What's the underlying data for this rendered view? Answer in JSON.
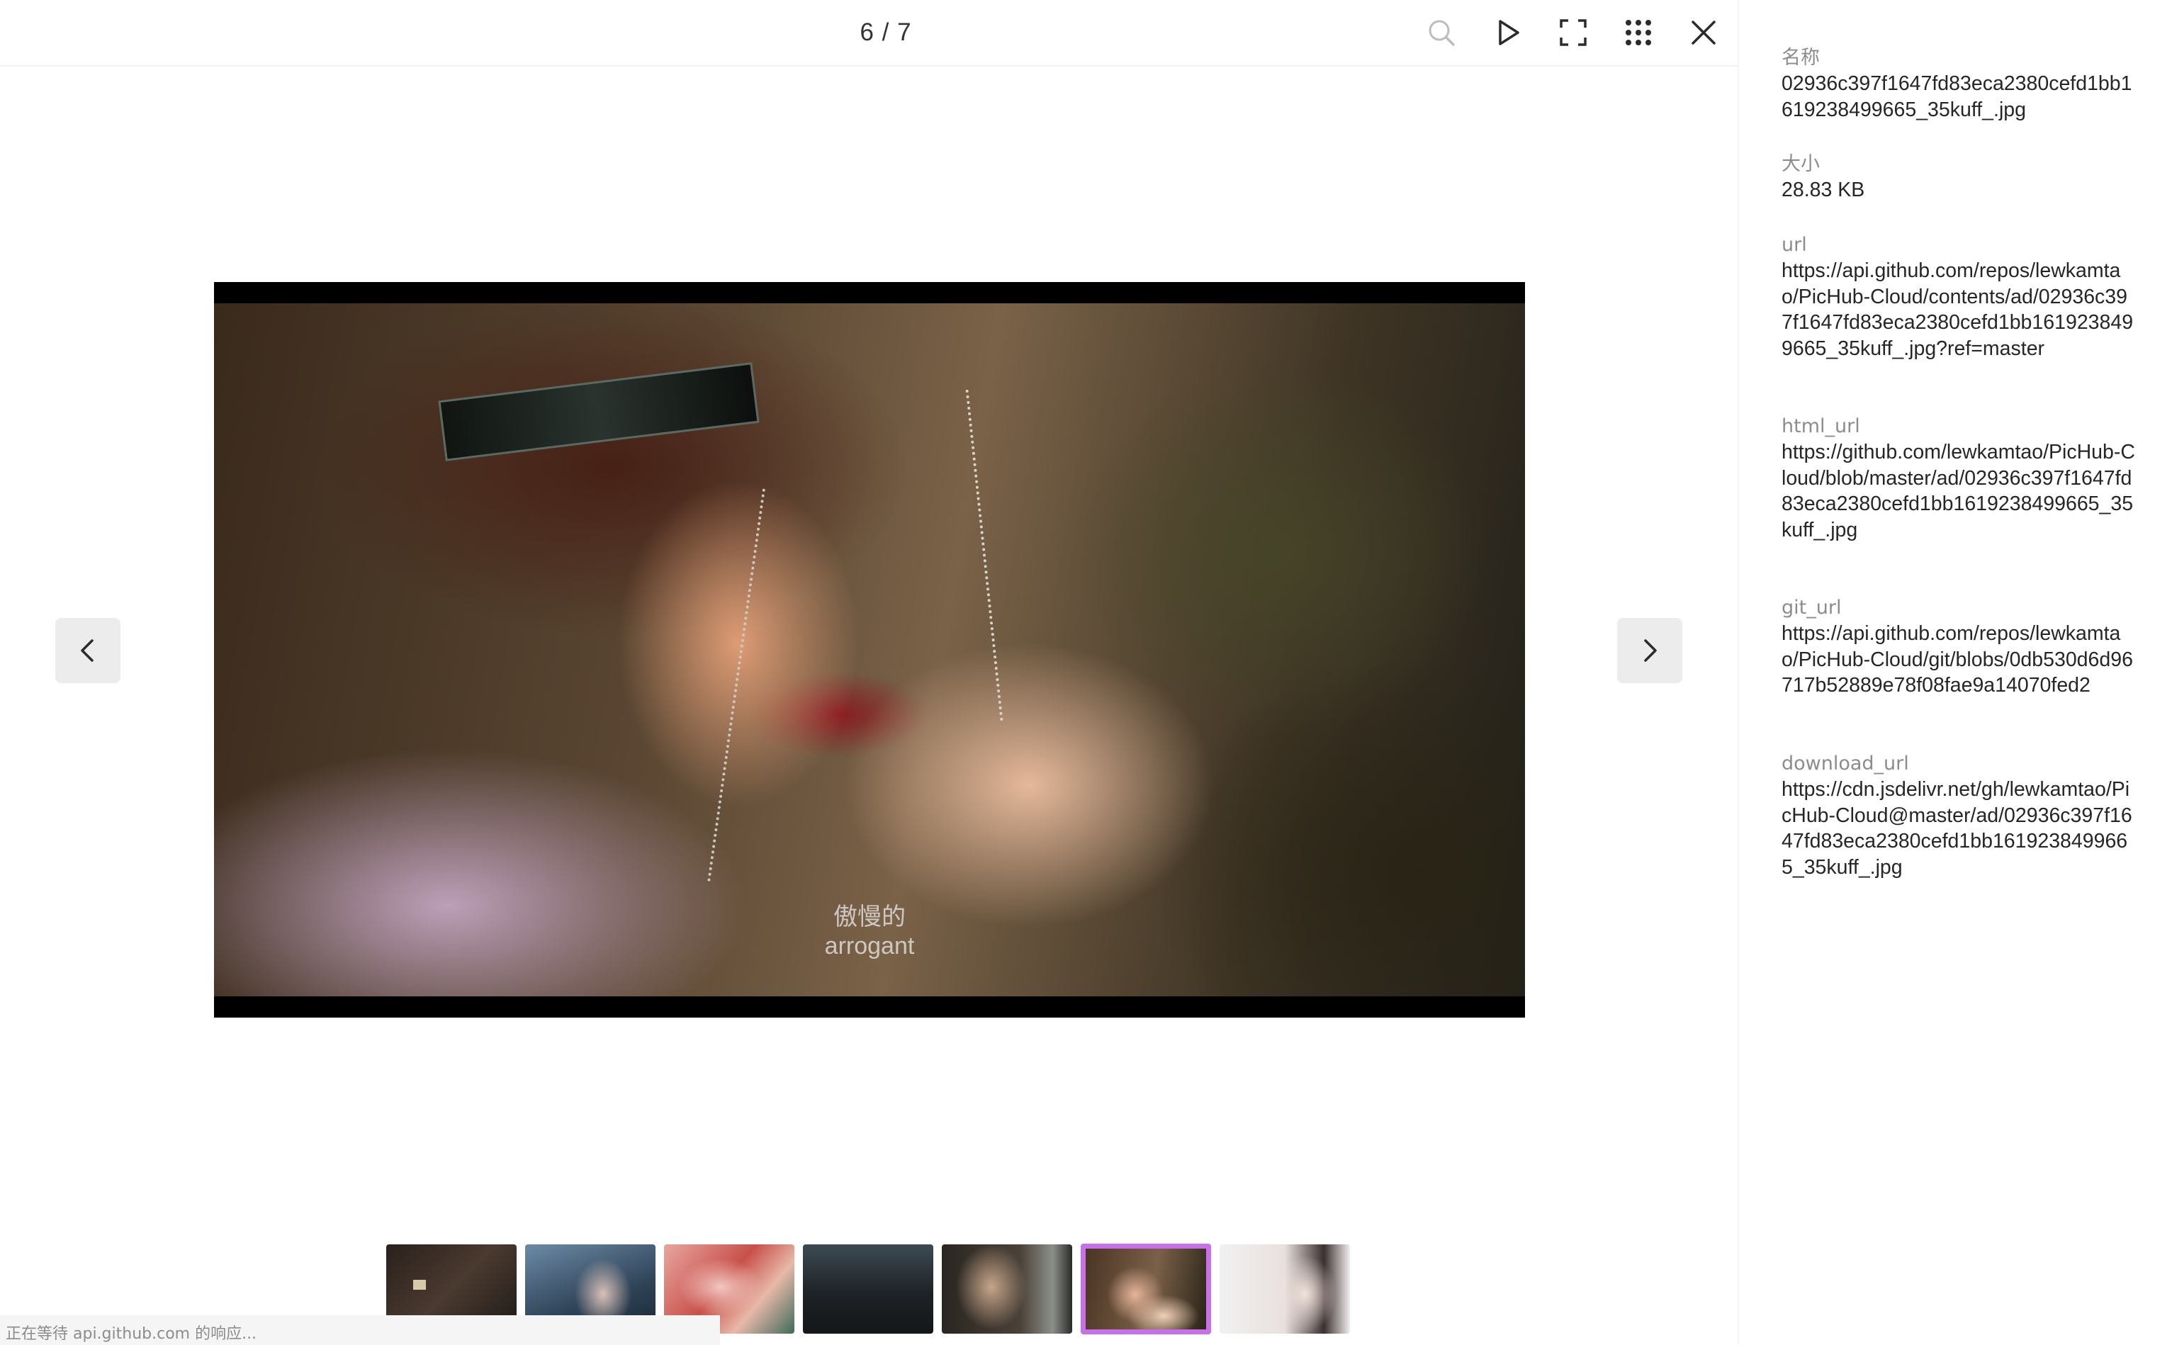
{
  "viewer": {
    "counter": "6 / 7",
    "toolbar": {
      "zoom_icon": "search-icon",
      "play_icon": "play-icon",
      "fullscreen_icon": "fullscreen-icon",
      "grid_icon": "grid-icon",
      "close_icon": "close-icon"
    },
    "image": {
      "subtitle_cn": "傲慢的",
      "subtitle_en": "arrogant"
    },
    "prev_icon": "chevron-left-icon",
    "next_icon": "chevron-right-icon",
    "thumbnails": [
      {
        "label": "thumbnail-1",
        "active": false
      },
      {
        "label": "thumbnail-2",
        "active": false
      },
      {
        "label": "thumbnail-3",
        "active": false
      },
      {
        "label": "thumbnail-4",
        "active": false
      },
      {
        "label": "thumbnail-5",
        "active": false
      },
      {
        "label": "thumbnail-6",
        "active": true
      },
      {
        "label": "thumbnail-7",
        "active": false
      }
    ],
    "accent_color": "#c770ea"
  },
  "status_bar": {
    "text": "正在等待 api.github.com 的响应..."
  },
  "info": {
    "name_label": "名称",
    "name_value": "02936c397f1647fd83eca2380cefd1bb1619238499665_35kuff_.jpg",
    "size_label": "大小",
    "size_value": "28.83 KB",
    "url_label": "url",
    "url_value": "https://api.github.com/repos/lewkamtao/PicHub-Cloud/contents/ad/02936c397f1647fd83eca2380cefd1bb1619238499665_35kuff_.jpg?ref=master",
    "html_url_label": "html_url",
    "html_url_value": "https://github.com/lewkamtao/PicHub-Cloud/blob/master/ad/02936c397f1647fd83eca2380cefd1bb1619238499665_35kuff_.jpg",
    "git_url_label": "git_url",
    "git_url_value": "https://api.github.com/repos/lewkamtao/PicHub-Cloud/git/blobs/0db530d6d96717b52889e78f08fae9a14070fed2",
    "download_url_label": "download_url",
    "download_url_value": "https://cdn.jsdelivr.net/gh/lewkamtao/PicHub-Cloud@master/ad/02936c397f1647fd83eca2380cefd1bb1619238499665_35kuff_.jpg"
  }
}
